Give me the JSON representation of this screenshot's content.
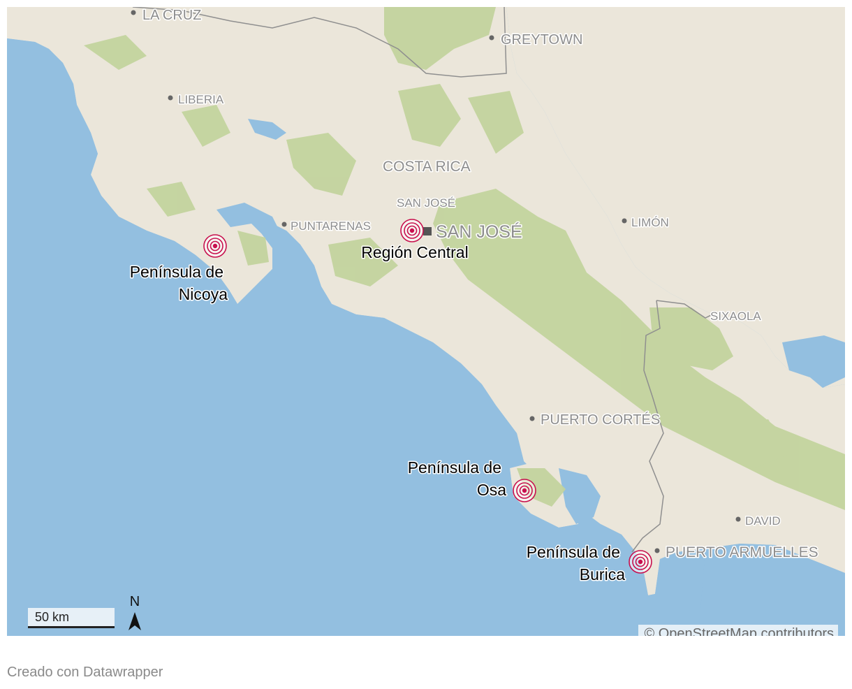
{
  "map": {
    "colors": {
      "water": "#93bfe0",
      "land": "#ebe6da",
      "forest": "#c3d49e",
      "border": "#8f8f8f",
      "marker": "#c8104e",
      "label": "#8d8d8d"
    },
    "places": [
      {
        "id": "la-cruz",
        "name": "LA CRUZ"
      },
      {
        "id": "greytown",
        "name": "GREYTOWN"
      },
      {
        "id": "liberia",
        "name": "LIBERIA"
      },
      {
        "id": "costa-rica",
        "name": "COSTA RICA"
      },
      {
        "id": "san-jose-region",
        "name": "SAN JOSÉ"
      },
      {
        "id": "san-jose-capital",
        "name": "SAN JOSÉ"
      },
      {
        "id": "puntarenas",
        "name": "PUNTARENAS"
      },
      {
        "id": "limon",
        "name": "LIMÓN"
      },
      {
        "id": "sixaola",
        "name": "SIXAOLA"
      },
      {
        "id": "puerto-cortes",
        "name": "PUERTO CORTÉS"
      },
      {
        "id": "david",
        "name": "DAVID"
      },
      {
        "id": "puerto-armuelles",
        "name": "PUERTO ARMUELLES"
      }
    ],
    "markers": [
      {
        "id": "nicoya",
        "label_line1": "Península de",
        "label_line2": "Nicoya",
        "icon": "epicenter-icon"
      },
      {
        "id": "central",
        "label_line1": "Región Central",
        "label_line2": "",
        "icon": "epicenter-icon"
      },
      {
        "id": "osa",
        "label_line1": "Península de",
        "label_line2": "Osa",
        "icon": "epicenter-icon"
      },
      {
        "id": "burica",
        "label_line1": "Península de",
        "label_line2": "Burica",
        "icon": "epicenter-icon"
      }
    ],
    "scale_label": "50 km",
    "north_label": "N",
    "attribution": "© OpenStreetMap contributors"
  },
  "footer": {
    "credit": "Creado con Datawrapper"
  }
}
